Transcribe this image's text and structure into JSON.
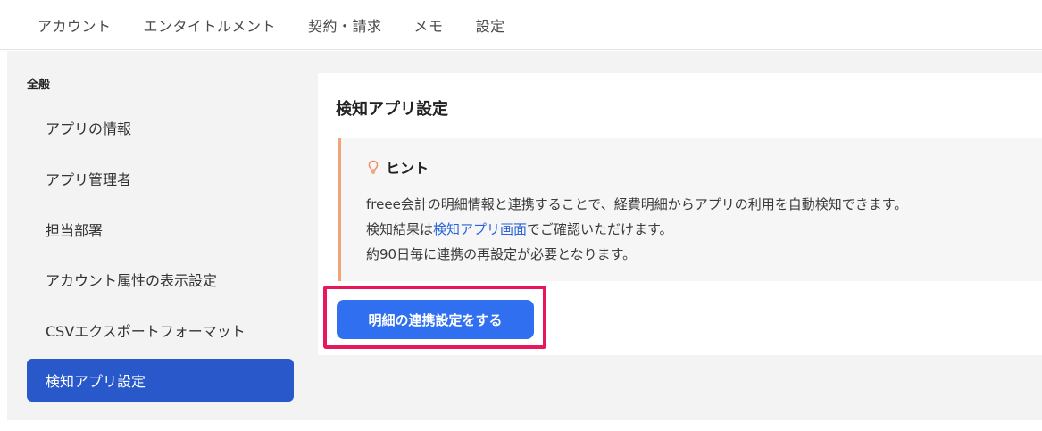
{
  "tabs": [
    {
      "label": "アカウント"
    },
    {
      "label": "エンタイトルメント"
    },
    {
      "label": "契約・請求"
    },
    {
      "label": "メモ"
    },
    {
      "label": "設定"
    }
  ],
  "sidebar": {
    "heading": "全般",
    "items": [
      {
        "label": "アプリの情報",
        "active": false
      },
      {
        "label": "アプリ管理者",
        "active": false
      },
      {
        "label": "担当部署",
        "active": false
      },
      {
        "label": "アカウント属性の表示設定",
        "active": false
      },
      {
        "label": "CSVエクスポートフォーマット",
        "active": false
      },
      {
        "label": "検知アプリ設定",
        "active": true
      }
    ]
  },
  "panel": {
    "title": "検知アプリ設定",
    "hint": {
      "icon": "lightbulb-icon",
      "title": "ヒント",
      "line1": "freee会計の明細情報と連携することで、経費明細からアプリの利用を自動検知できます。",
      "line2_prefix": "検知結果は",
      "line2_link": "検知アプリ画面",
      "line2_suffix": "でご確認いただけます。",
      "line3": "約90日毎に連携の再設定が必要となります。"
    },
    "button_label": "明細の連携設定をする"
  },
  "colors": {
    "accent": "#2f6ff0",
    "sidebar_active": "#2858c9",
    "hint_border": "#f3a37a",
    "highlight": "#e8175d",
    "link": "#2a63d6"
  }
}
